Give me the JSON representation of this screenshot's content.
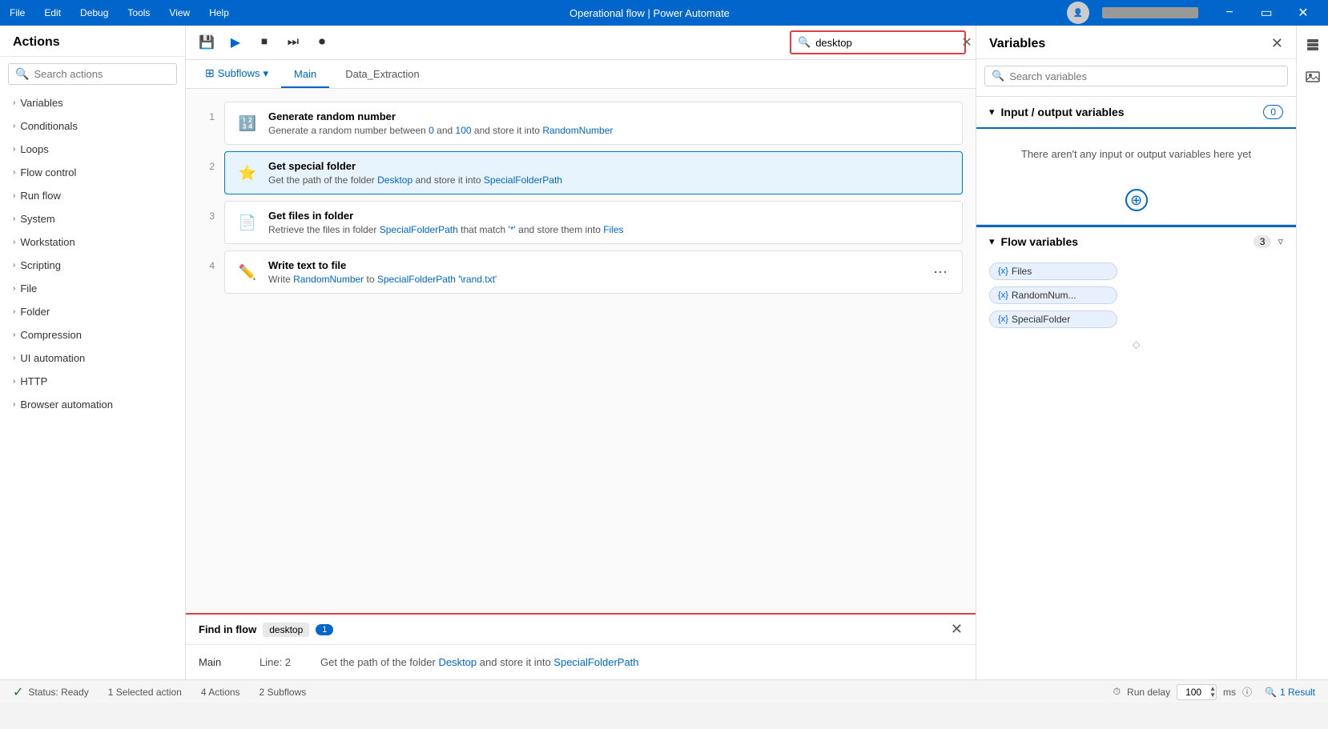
{
  "app": {
    "title": "Operational flow | Power Automate",
    "minimize_label": "−",
    "restore_label": "▭",
    "close_label": "✕"
  },
  "menubar": {
    "items": [
      "File",
      "Edit",
      "Debug",
      "Tools",
      "View",
      "Help"
    ]
  },
  "toolbar": {
    "save_icon": "💾",
    "run_icon": "▶",
    "stop_icon": "⏹",
    "next_icon": "⏭",
    "record_icon": "⏺",
    "search_placeholder": "desktop",
    "search_value": "desktop"
  },
  "actions_panel": {
    "title": "Actions",
    "search_placeholder": "Search actions",
    "items": [
      {
        "label": "Variables"
      },
      {
        "label": "Conditionals"
      },
      {
        "label": "Loops"
      },
      {
        "label": "Flow control"
      },
      {
        "label": "Run flow"
      },
      {
        "label": "System"
      },
      {
        "label": "Workstation"
      },
      {
        "label": "Scripting"
      },
      {
        "label": "File"
      },
      {
        "label": "Folder"
      },
      {
        "label": "Compression"
      },
      {
        "label": "UI automation"
      },
      {
        "label": "HTTP"
      },
      {
        "label": "Browser automation"
      }
    ]
  },
  "tabs": {
    "subflows_label": "Subflows",
    "items": [
      {
        "label": "Main",
        "active": true
      },
      {
        "label": "Data_Extraction",
        "active": false
      }
    ]
  },
  "flow_steps": [
    {
      "num": "1",
      "title": "Generate random number",
      "desc_prefix": "Generate a random number between",
      "desc_from": "0",
      "desc_mid": "and",
      "desc_to": "100",
      "desc_suffix": "and store it into",
      "desc_var": "RandomNumber",
      "icon": "🔢"
    },
    {
      "num": "2",
      "title": "Get special folder",
      "desc_prefix": "Get the path of the folder",
      "desc_folder": "Desktop",
      "desc_mid": "and store it into",
      "desc_var": "SpecialFolderPath",
      "icon": "⭐",
      "highlighted": true
    },
    {
      "num": "3",
      "title": "Get files in folder",
      "desc_prefix": "Retrieve the files in folder",
      "desc_var1": "SpecialFolderPath",
      "desc_mid": "that match",
      "desc_str": "'*'",
      "desc_suffix": "and store them into",
      "desc_var2": "Files",
      "icon": "📄"
    },
    {
      "num": "4",
      "title": "Write text to file",
      "desc_prefix": "Write",
      "desc_var1": "RandomNumber",
      "desc_mid": "to",
      "desc_var2": "SpecialFolderPath",
      "desc_str": "'\\rand.txt'",
      "icon": "✏️"
    }
  ],
  "variables_panel": {
    "title": "Variables",
    "search_placeholder": "Search variables",
    "input_output_section": {
      "title": "Input / output variables",
      "count": "0",
      "empty_message": "There aren't any input or output variables here yet"
    },
    "flow_variables_section": {
      "title": "Flow variables",
      "count": "3",
      "items": [
        {
          "label": "Files",
          "prefix": "{x}"
        },
        {
          "label": "RandomNum...",
          "prefix": "{x}"
        },
        {
          "label": "SpecialFolder",
          "prefix": "{x}"
        }
      ]
    }
  },
  "find_panel": {
    "title": "Find in flow",
    "keyword": "desktop",
    "count": "1",
    "results": [
      {
        "tab": "Main",
        "line": "Line: 2",
        "desc_prefix": "Get the path of the folder",
        "desc_highlight": "Desktop",
        "desc_mid": "and store it into",
        "desc_var": "SpecialFolderPath"
      }
    ]
  },
  "statusbar": {
    "status_label": "Status: Ready",
    "selected": "1 Selected action",
    "actions_count": "4 Actions",
    "subflows_count": "2 Subflows",
    "run_delay_label": "Run delay",
    "run_delay_value": "100",
    "run_delay_unit": "ms",
    "result_label": "1 Result"
  }
}
